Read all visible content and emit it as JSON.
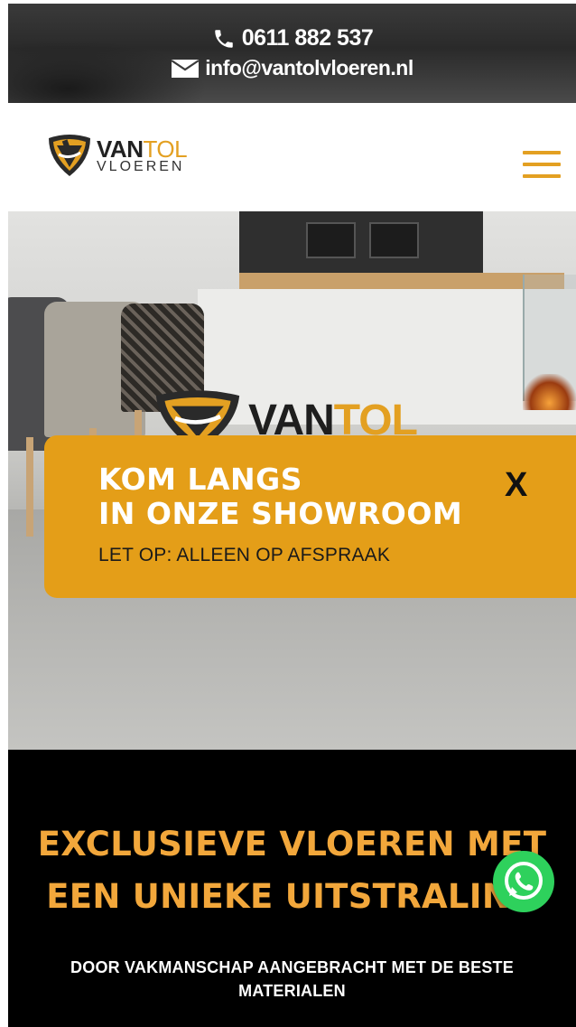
{
  "topbar": {
    "phone": "0611 882 537",
    "email": "info@vantolvloeren.nl",
    "phone_icon": "phone-icon",
    "email_icon": "envelope-icon"
  },
  "header": {
    "logo_line1_a": "VAN",
    "logo_line1_b": "TOL",
    "logo_line2": "VLOEREN",
    "menu_icon": "hamburger-menu-icon"
  },
  "hero": {
    "logo_a": "VAN",
    "logo_b": "TOL"
  },
  "popup": {
    "title_line1": "KOM LANGS",
    "title_line2": "IN ONZE SHOWROOM",
    "note": "LET OP: ALLEEN OP AFSPRAAK",
    "close_label": "X"
  },
  "promo": {
    "headline_line1": "EXCLUSIEVE VLOEREN MET",
    "headline_line2": "EEN UNIEKE UITSTRALING",
    "sub_line1": "DOOR VAKMANSCHAP AANGEBRACHT MET DE BESTE",
    "sub_line2": "MATERIALEN"
  },
  "whatsapp": {
    "icon": "whatsapp-icon"
  },
  "colors": {
    "accent": "#e3a022",
    "popup_bg": "#e49e18",
    "promo_text": "#f2a73b",
    "whatsapp": "#2ed15c"
  }
}
